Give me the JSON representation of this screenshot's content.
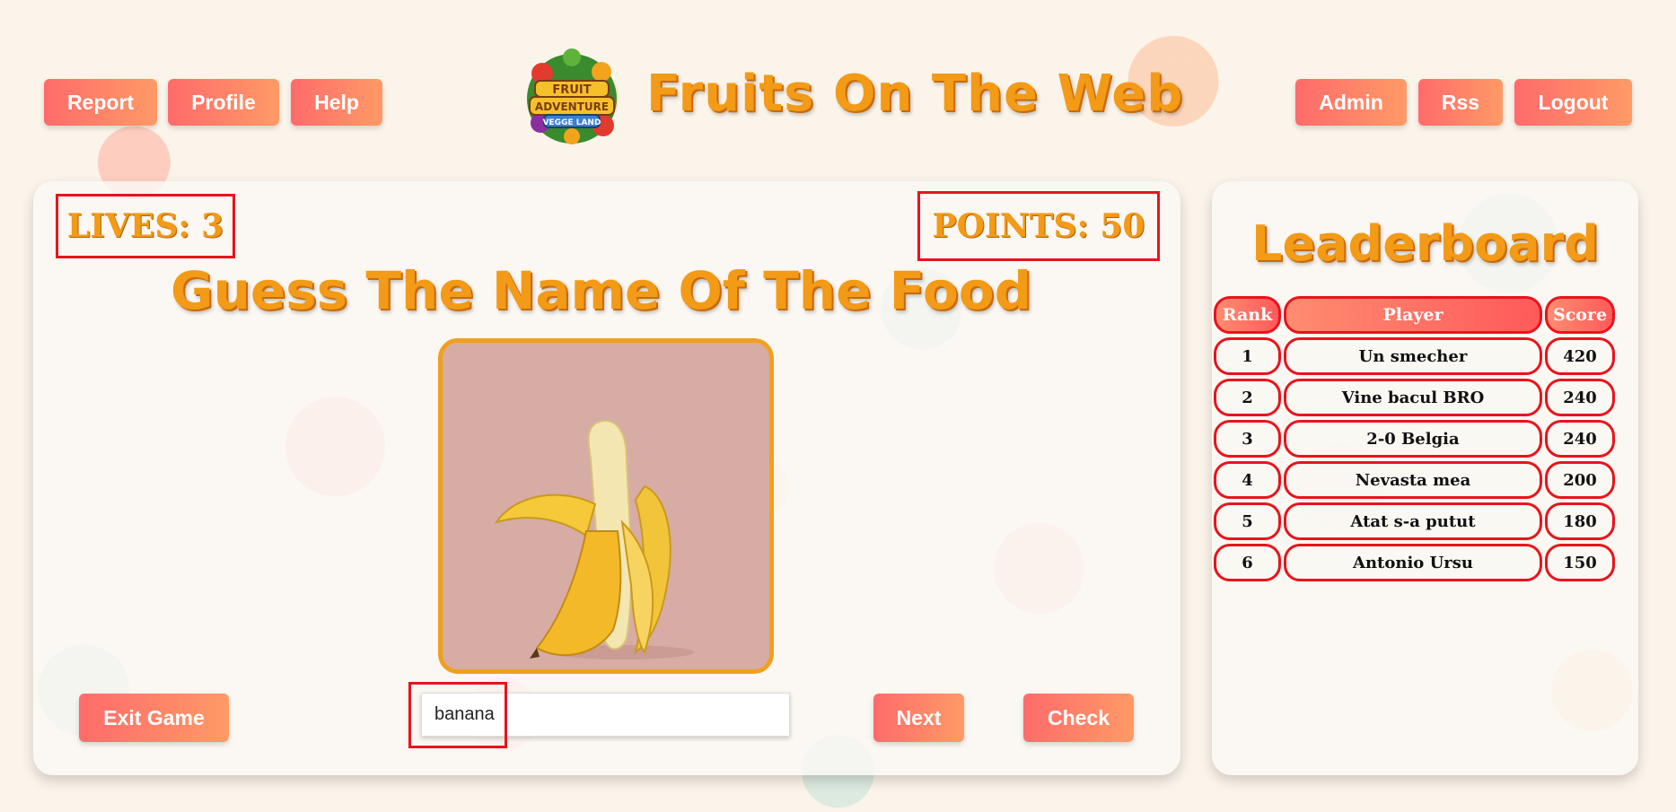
{
  "header": {
    "title": "Fruits On The Web",
    "logo_text": [
      "FRUIT",
      "ADVENTURE",
      "VEGGE LAND"
    ],
    "nav_left": [
      "Report",
      "Profile",
      "Help"
    ],
    "nav_right": [
      "Admin",
      "Rss",
      "Logout"
    ]
  },
  "game": {
    "lives_label": "LIVES: 3",
    "points_label": "POINTS: 50",
    "title": "Guess The Name Of The Food",
    "image_icon": "banana-image",
    "answer_value": "banana",
    "exit_label": "Exit Game",
    "next_label": "Next",
    "check_label": "Check"
  },
  "leaderboard": {
    "title": "Leaderboard",
    "columns": [
      "Rank",
      "Player",
      "Score"
    ],
    "rows": [
      {
        "rank": "1",
        "player": "Un smecher",
        "score": "420"
      },
      {
        "rank": "2",
        "player": "Vine bacul BRO",
        "score": "240"
      },
      {
        "rank": "3",
        "player": "2-0 Belgia",
        "score": "240"
      },
      {
        "rank": "4",
        "player": "Nevasta mea",
        "score": "200"
      },
      {
        "rank": "5",
        "player": "Atat s-a putut",
        "score": "180"
      },
      {
        "rank": "6",
        "player": "Antonio Ursu",
        "score": "150"
      }
    ]
  },
  "colors": {
    "accent_orange": "#f39a16",
    "button_gradient_start": "#ff6b6b",
    "button_gradient_end": "#ff9a66",
    "highlight_red": "#e8141c"
  }
}
